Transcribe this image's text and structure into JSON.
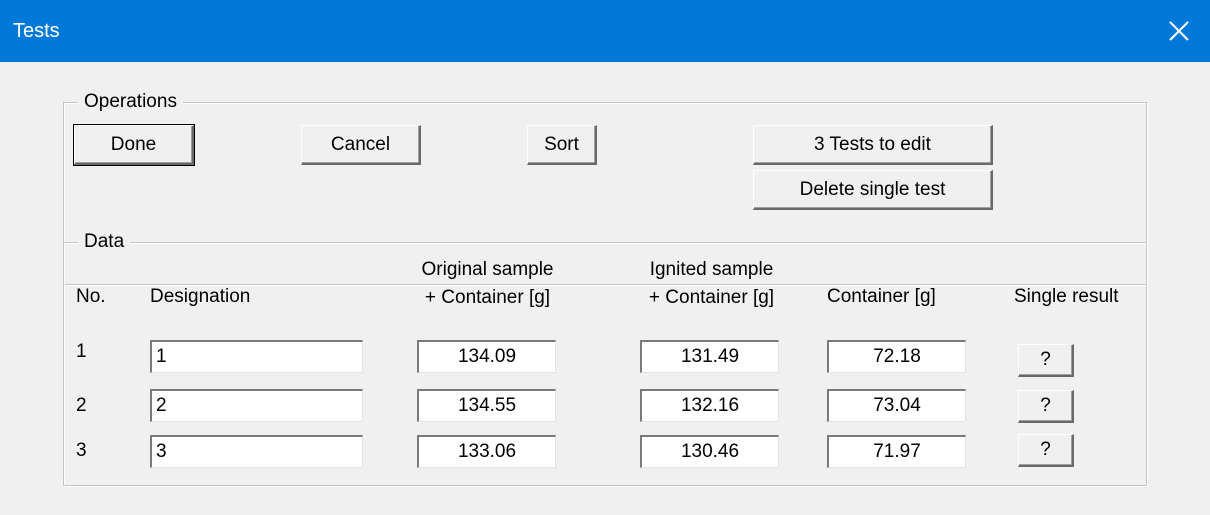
{
  "window": {
    "title": "Tests",
    "close_glyph": "✕"
  },
  "operations": {
    "legend": "Operations",
    "done_label": "Done",
    "cancel_label": "Cancel",
    "sort_label": "Sort",
    "edit_tests_label": "3 Tests to edit",
    "delete_single_label": "Delete single test"
  },
  "data_group": {
    "legend": "Data",
    "headers": {
      "no": "No.",
      "designation": "Designation",
      "original_line1": "Original sample",
      "original_line2": "+ Container [g]",
      "ignited_line1": "Ignited sample",
      "ignited_line2": "+ Container [g]",
      "container": "Container [g]",
      "single_result": "Single result"
    },
    "rows": [
      {
        "no": "1",
        "designation": "1",
        "original": "134.09",
        "ignited": "131.49",
        "container": "72.18",
        "result_label": "?"
      },
      {
        "no": "2",
        "designation": "2",
        "original": "134.55",
        "ignited": "132.16",
        "container": "73.04",
        "result_label": "?"
      },
      {
        "no": "3",
        "designation": "3",
        "original": "133.06",
        "ignited": "130.46",
        "container": "71.97",
        "result_label": "?"
      }
    ]
  }
}
